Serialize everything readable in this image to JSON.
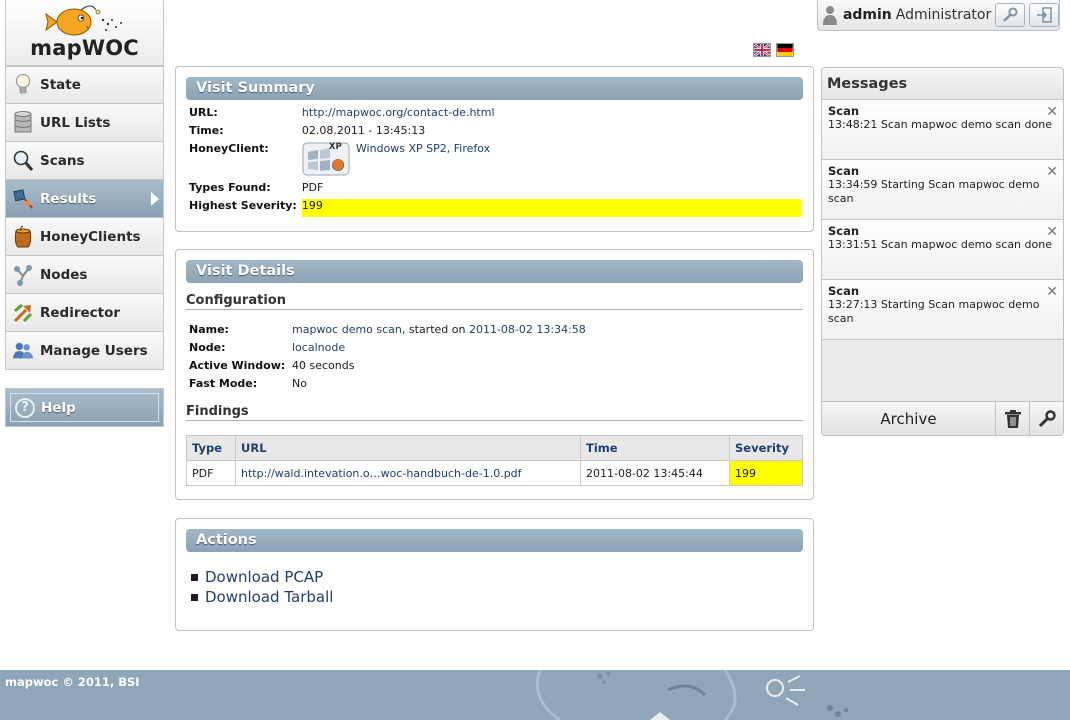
{
  "app": {
    "name": "mapWOC"
  },
  "nav": {
    "items": [
      {
        "label": "State",
        "icon": "lightbulb-icon"
      },
      {
        "label": "URL Lists",
        "icon": "database-icon"
      },
      {
        "label": "Scans",
        "icon": "magnifier-icon"
      },
      {
        "label": "Results",
        "icon": "results-icon",
        "active": true
      },
      {
        "label": "HoneyClients",
        "icon": "honeypot-icon"
      },
      {
        "label": "Nodes",
        "icon": "nodes-icon"
      },
      {
        "label": "Redirector",
        "icon": "redirect-arrows-icon"
      },
      {
        "label": "Manage Users",
        "icon": "users-icon"
      }
    ],
    "help": "Help"
  },
  "user": {
    "name": "admin",
    "role": "Administrator"
  },
  "languages": [
    "en",
    "de"
  ],
  "summary": {
    "title": "Visit Summary",
    "url_label": "URL:",
    "url": "http://mapwoc.org/contact-de.html",
    "time_label": "Time:",
    "time": "02.08.2011 - 13:45:13",
    "honeyclient_label": "HoneyClient:",
    "honeyclient": "Windows XP SP2, Firefox",
    "xp_badge": "XP",
    "types_label": "Types Found:",
    "types": "PDF",
    "severity_label": "Highest Severity:",
    "severity": "199",
    "highlight_color": "#ffff00"
  },
  "details": {
    "title": "Visit Details",
    "configuration_heading": "Configuration",
    "name_label": "Name:",
    "name_link": "mapwoc demo scan",
    "name_mid": ", started on ",
    "name_date": "2011-08-02 13:34:58",
    "node_label": "Node:",
    "node": "localnode",
    "window_label": "Active Window:",
    "window": "40 seconds",
    "fast_label": "Fast Mode:",
    "fast": "No",
    "findings_heading": "Findings",
    "columns": {
      "type": "Type",
      "url": "URL",
      "time": "Time",
      "severity": "Severity"
    },
    "rows": [
      {
        "type": "PDF",
        "url": "http://wald.intevation.o…woc-handbuch-de-1.0.pdf",
        "time": "2011-08-02 13:45:44",
        "severity": "199"
      }
    ]
  },
  "actions": {
    "title": "Actions",
    "items": [
      "Download PCAP",
      "Download Tarball"
    ]
  },
  "messages": {
    "title": "Messages",
    "items": [
      {
        "title": "Scan",
        "body": "13:48:21 Scan mapwoc demo scan done"
      },
      {
        "title": "Scan",
        "body": "13:34:59 Starting Scan mapwoc demo scan"
      },
      {
        "title": "Scan",
        "body": "13:31:51 Scan mapwoc demo scan done"
      },
      {
        "title": "Scan",
        "body": "13:27:13 Starting Scan mapwoc demo scan"
      }
    ],
    "close_glyph": "✕",
    "archive": "Archive"
  },
  "footer": {
    "text": "mapwoc © 2011, BSI"
  }
}
